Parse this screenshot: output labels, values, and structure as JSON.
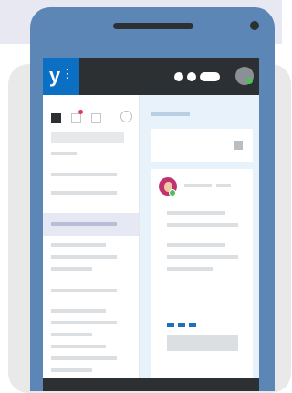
{
  "app": {
    "logo_text": "y",
    "logo_icon": "yammer-logo-icon",
    "brand_color": "#0b6fc4",
    "appbar_color": "#2c3033"
  },
  "header": {
    "overflow_icon": "more-dots-icon",
    "avatar_icon": "user-avatar-icon",
    "presence_color": "#4cc15a"
  },
  "sidebar": {
    "tools": [
      "filled-square-icon",
      "outline-square-icon",
      "outline-square-icon",
      "circle-icon"
    ],
    "notification_color": "#e8384f",
    "selected_background": "#e6e8f4"
  },
  "feed": {
    "background": "#e8f2fa",
    "attachment_color": "#1f6fc1",
    "post_avatar_icon": "user-avatar-icon"
  }
}
